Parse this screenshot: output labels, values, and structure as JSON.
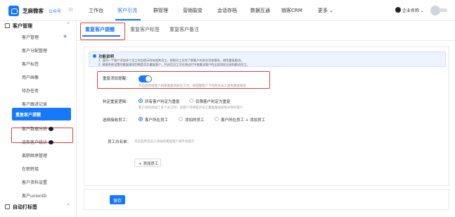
{
  "header": {
    "brand": "芝麻微客",
    "brand_tag": "公众号",
    "nav": [
      "工作台",
      "客户引流",
      "群管理",
      "营销裂变",
      "会话存档",
      "数据互通",
      "销客CRM",
      "更多 ⌄"
    ],
    "active_nav": "客户引流",
    "user_name": "企业名称"
  },
  "sidebar": {
    "group1": "客户管理",
    "group2": "自动打标签",
    "items": [
      "客户管理",
      "客户分配管理",
      "客户标签",
      "用户画像",
      "待办任务",
      "客户跟进记录",
      "重复客户提醒",
      "客户数据分析",
      "流失客户统计",
      "离职继承管理",
      "在职转接",
      "客户资料设置",
      "客户unionID"
    ],
    "active_item": "重复客户提醒"
  },
  "tabs": [
    "重复客户提醒",
    "重复客户标签",
    "重复客户备注"
  ],
  "notice": {
    "title": "功能说明",
    "lines": [
      "1. 当同一个客户添加多个员工时会提示所有相关员工，帮助员工及时了解客户的多次添加情况，避免重复跟进。",
      "2. 根据系统设置的重复规则判断是否为重复客户，开启后员工可在侧边栏中查看该客户的全部添加记录和跟进员工。"
    ]
  },
  "form": {
    "toggle_label": "重复添加提醒：",
    "toggle_hint": "开启后新增客户如果重复添加员工时，将提醒客户下的所有员工避免重复跟进",
    "rule_label": "判定重复逻辑：",
    "rule_options": [
      "所有客户判定为重复",
      "仅限客户判定为重复"
    ],
    "rule_hint": "客户同时添加了多个员工时，该客户可将提示员工重复跟进避免冲突的客户",
    "scope_label": "选择接收员工：",
    "scope_options": [
      "客户所在员工",
      "添加的员工",
      "客户所在员工 + 添加员工"
    ],
    "whitelist_label": "员工白名单：",
    "whitelist_hint": "开启后所选员工添加的重复客户将不会提示",
    "add_button": "+ 添加员工"
  },
  "actions": {
    "save": "保存"
  }
}
